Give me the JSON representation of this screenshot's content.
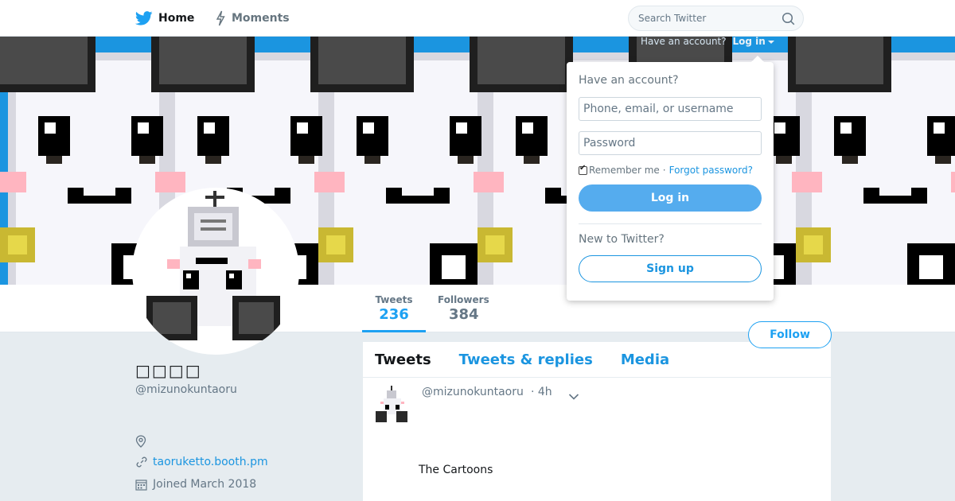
{
  "nav": {
    "home_label": "Home",
    "moments_label": "Moments",
    "search_placeholder": "Search Twitter"
  },
  "banner": {
    "have_account_text": "Have an account?",
    "login_toggle_label": "Log in"
  },
  "login_dropdown": {
    "heading": "Have an account?",
    "username_placeholder": "Phone, email, or username",
    "password_placeholder": "Password",
    "remember_label": "Remember me",
    "separator": "·",
    "forgot_label": "Forgot password?",
    "login_button": "Log in",
    "new_heading": "New to Twitter?",
    "signup_button": "Sign up"
  },
  "profile_nav": {
    "stats": [
      {
        "label": "Tweets",
        "value": "236"
      },
      {
        "label": "Followers",
        "value": "384"
      }
    ],
    "follow_button": "Follow"
  },
  "profile": {
    "name": "□□□□",
    "handle": "@mizunokuntaoru",
    "link": "taoruketto.booth.pm",
    "joined": "Joined March 2018"
  },
  "timeline": {
    "tabs": [
      "Tweets",
      "Tweets & replies",
      "Media"
    ],
    "tweet": {
      "handle": "@mizunokuntaoru",
      "time": "· 4h",
      "text": "The Cartoons"
    }
  },
  "colors": {
    "accent": "#1da1f2",
    "banner_bg": "#1b95e0",
    "page_bg": "#e6ecf0"
  },
  "icons": {
    "home": "twitter-bird-icon",
    "moments": "lightning-icon",
    "search": "search-icon",
    "location": "location-pin-icon",
    "link": "link-icon",
    "joined": "calendar-icon",
    "tweet_menu": "chevron-down-icon"
  }
}
